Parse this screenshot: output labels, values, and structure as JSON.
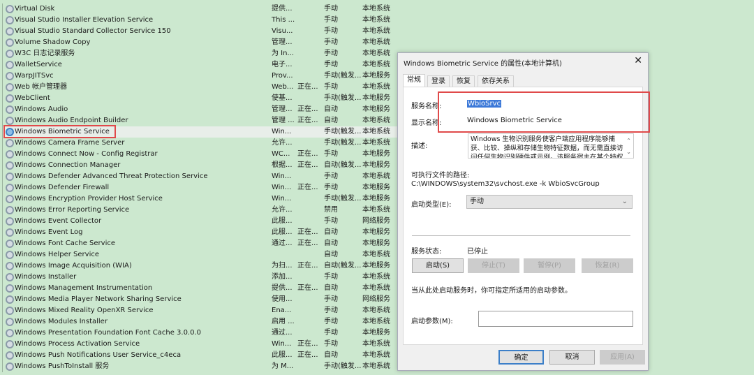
{
  "services": [
    {
      "name": "Virtual Disk",
      "desc": "提供...",
      "status": "",
      "startup": "手动",
      "logon": "本地系统"
    },
    {
      "name": "Visual Studio Installer Elevation Service",
      "desc": "This ...",
      "status": "",
      "startup": "手动",
      "logon": "本地系统"
    },
    {
      "name": "Visual Studio Standard Collector Service 150",
      "desc": "Visu...",
      "status": "",
      "startup": "手动",
      "logon": "本地系统"
    },
    {
      "name": "Volume Shadow Copy",
      "desc": "管理...",
      "status": "",
      "startup": "手动",
      "logon": "本地系统"
    },
    {
      "name": "W3C 日志记录服务",
      "desc": "为 In...",
      "status": "",
      "startup": "手动",
      "logon": "本地系统"
    },
    {
      "name": "WalletService",
      "desc": "电子...",
      "status": "",
      "startup": "手动",
      "logon": "本地系统"
    },
    {
      "name": "WarpJITSvc",
      "desc": "Prov...",
      "status": "",
      "startup": "手动(触发...",
      "logon": "本地服务"
    },
    {
      "name": "Web 帐户管理器",
      "desc": "Web...",
      "status": "正在...",
      "startup": "手动",
      "logon": "本地系统"
    },
    {
      "name": "WebClient",
      "desc": "使基...",
      "status": "",
      "startup": "手动(触发...",
      "logon": "本地服务"
    },
    {
      "name": "Windows Audio",
      "desc": "管理...",
      "status": "正在...",
      "startup": "自动",
      "logon": "本地服务"
    },
    {
      "name": "Windows Audio Endpoint Builder",
      "desc": "管理 ...",
      "status": "正在...",
      "startup": "自动",
      "logon": "本地系统"
    },
    {
      "name": "Windows Biometric Service",
      "desc": "Win...",
      "status": "",
      "startup": "手动(触发...",
      "logon": "本地系统",
      "selected": true
    },
    {
      "name": "Windows Camera Frame Server",
      "desc": "允许...",
      "status": "",
      "startup": "手动(触发...",
      "logon": "本地系统"
    },
    {
      "name": "Windows Connect Now - Config Registrar",
      "desc": "WC...",
      "status": "正在...",
      "startup": "手动",
      "logon": "本地服务"
    },
    {
      "name": "Windows Connection Manager",
      "desc": "根据...",
      "status": "正在...",
      "startup": "自动(触发...",
      "logon": "本地服务"
    },
    {
      "name": "Windows Defender Advanced Threat Protection Service",
      "desc": "Win...",
      "status": "",
      "startup": "手动",
      "logon": "本地系统"
    },
    {
      "name": "Windows Defender Firewall",
      "desc": "Win...",
      "status": "正在...",
      "startup": "手动",
      "logon": "本地服务"
    },
    {
      "name": "Windows Encryption Provider Host Service",
      "desc": "Win...",
      "status": "",
      "startup": "手动(触发...",
      "logon": "本地服务"
    },
    {
      "name": "Windows Error Reporting Service",
      "desc": "允许...",
      "status": "",
      "startup": "禁用",
      "logon": "本地系统"
    },
    {
      "name": "Windows Event Collector",
      "desc": "此服...",
      "status": "",
      "startup": "手动",
      "logon": "网络服务"
    },
    {
      "name": "Windows Event Log",
      "desc": "此服...",
      "status": "正在...",
      "startup": "自动",
      "logon": "本地服务"
    },
    {
      "name": "Windows Font Cache Service",
      "desc": "通过...",
      "status": "正在...",
      "startup": "自动",
      "logon": "本地服务"
    },
    {
      "name": "Windows Helper Service",
      "desc": "",
      "status": "",
      "startup": "自动",
      "logon": "本地系统"
    },
    {
      "name": "Windows Image Acquisition (WIA)",
      "desc": "为扫...",
      "status": "正在...",
      "startup": "自动(触发...",
      "logon": "本地服务"
    },
    {
      "name": "Windows Installer",
      "desc": "添加...",
      "status": "",
      "startup": "手动",
      "logon": "本地系统"
    },
    {
      "name": "Windows Management Instrumentation",
      "desc": "提供...",
      "status": "正在...",
      "startup": "自动",
      "logon": "本地系统"
    },
    {
      "name": "Windows Media Player Network Sharing Service",
      "desc": "使用...",
      "status": "",
      "startup": "手动",
      "logon": "网络服务"
    },
    {
      "name": "Windows Mixed Reality OpenXR Service",
      "desc": "Ena...",
      "status": "",
      "startup": "手动",
      "logon": "本地系统"
    },
    {
      "name": "Windows Modules Installer",
      "desc": "启用 ...",
      "status": "",
      "startup": "手动",
      "logon": "本地系统"
    },
    {
      "name": "Windows Presentation Foundation Font Cache 3.0.0.0",
      "desc": "通过...",
      "status": "",
      "startup": "手动",
      "logon": "本地服务"
    },
    {
      "name": "Windows Process Activation Service",
      "desc": "Win...",
      "status": "正在...",
      "startup": "手动",
      "logon": "本地系统"
    },
    {
      "name": "Windows Push Notifications User Service_c4eca",
      "desc": "此服...",
      "status": "正在...",
      "startup": "自动",
      "logon": "本地系统"
    },
    {
      "name": "Windows PushToInstall 服务",
      "desc": "为 M...",
      "status": "",
      "startup": "手动(触发...",
      "logon": "本地系统"
    }
  ],
  "dialog": {
    "title": "Windows Biometric Service 的属性(本地计算机)",
    "tabs": [
      "常规",
      "登录",
      "恢复",
      "依存关系"
    ],
    "service_name_label": "服务名称:",
    "service_name": "WbioSrvc",
    "display_name_label": "显示名称:",
    "display_name": "Windows Biometric Service",
    "desc_label": "描述:",
    "description": "Windows 生物识别服务使客户端应用程序能够捕获、比较、操纵和存储生物特征数据，而无需直接访问任何生物识别硬件或示例。该服务宿主在某个特权",
    "path_label": "可执行文件的路径:",
    "path": "C:\\WINDOWS\\system32\\svchost.exe -k WbioSvcGroup",
    "startup_label": "启动类型(E):",
    "startup_value": "手动",
    "status_label": "服务状态:",
    "status_value": "已停止",
    "btn_start": "启动(S)",
    "btn_stop": "停止(T)",
    "btn_pause": "暂停(P)",
    "btn_resume": "恢复(R)",
    "hint": "当从此处启动服务时，你可指定所适用的启动参数。",
    "param_label": "启动参数(M):",
    "param_value": "",
    "ok": "确定",
    "cancel": "取消",
    "apply": "应用(A)"
  }
}
